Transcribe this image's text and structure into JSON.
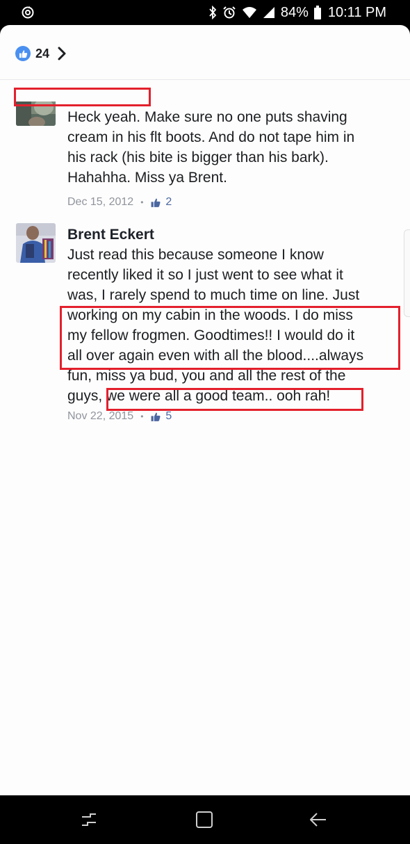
{
  "status_bar": {
    "battery": "84%",
    "time": "10:11 PM",
    "icons": [
      "sync-icon",
      "bluetooth-icon",
      "alarm-icon",
      "wifi-icon",
      "signal-icon",
      "battery-icon"
    ]
  },
  "reactions": {
    "count": "24",
    "icon": "like-icon"
  },
  "comments": [
    {
      "author": "",
      "text_lines": [
        "Heck yeah. Make sure no one puts shaving",
        "cream in his flt boots. And do not tape him in",
        "his rack (his bite is bigger than his bark).",
        "Hahahha. Miss ya Brent."
      ],
      "date": "Dec 15, 2012",
      "likes": "2"
    },
    {
      "author": "Brent Eckert",
      "text_lines": [
        "Just read this because someone I know",
        "recently liked it so I just went to see what it",
        "was, I rarely spend to much time on line. Just",
        "working on my cabin in the woods. I do miss",
        "my fellow frogmen. Goodtimes!! I would do it",
        "all over again even with all the blood....always",
        "fun, miss ya bud, you and all the rest of the",
        "guys, we were all a good team.. ooh rah!"
      ],
      "date": "Nov 22, 2015",
      "likes": "5"
    }
  ],
  "meta_separator": "•",
  "colors": {
    "annotation": "#e3202c",
    "like_blue": "#4a90f0",
    "link_blue": "#4b67a1",
    "meta_gray": "#90949c"
  },
  "nav_bar": {
    "buttons": [
      "recent-apps-icon",
      "home-icon",
      "back-icon"
    ]
  }
}
